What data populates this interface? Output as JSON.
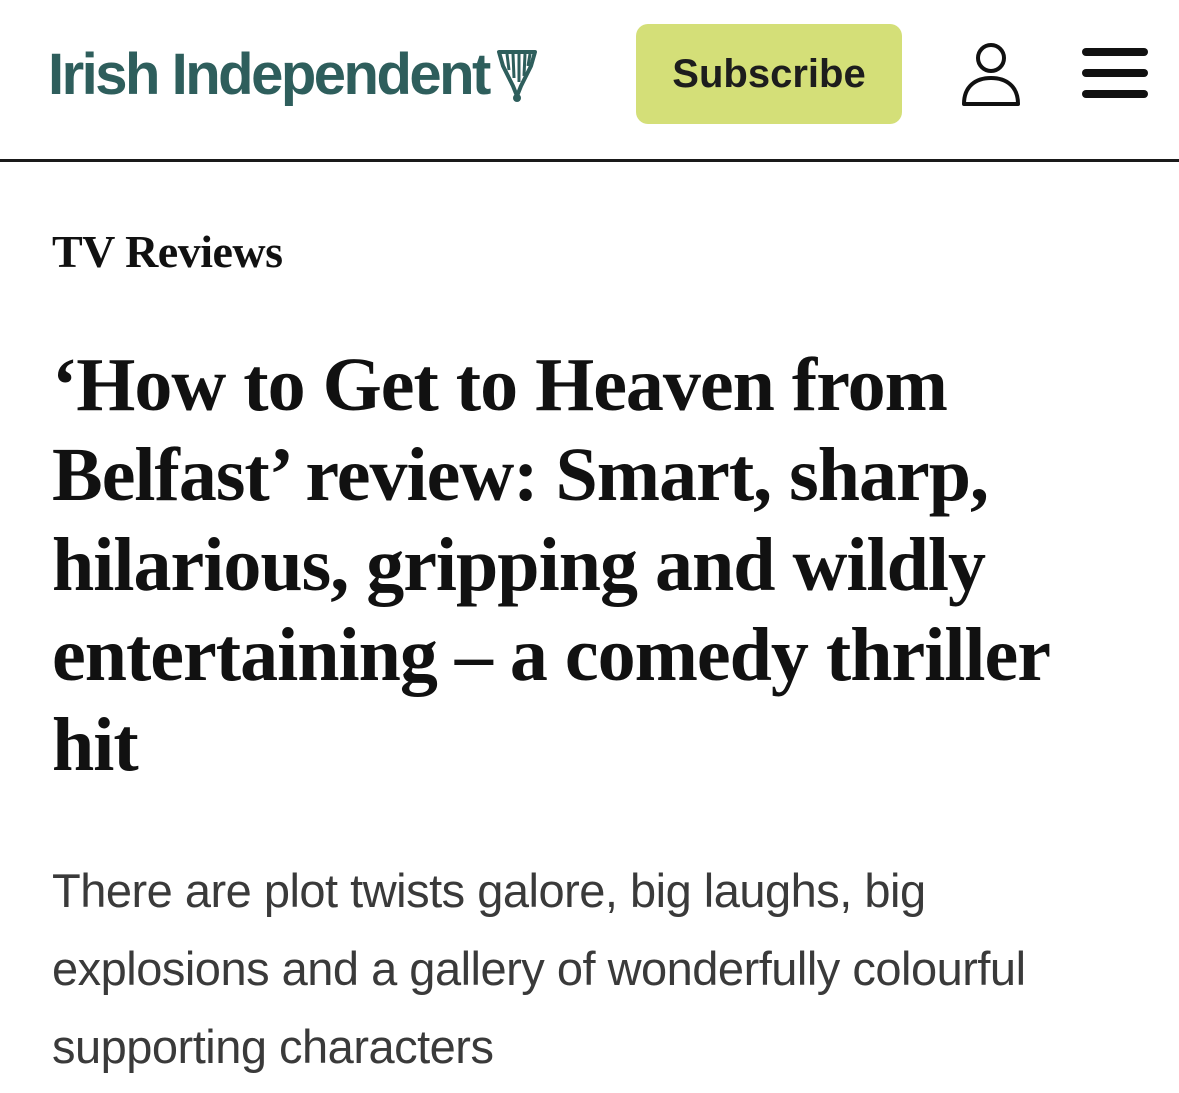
{
  "header": {
    "brand_name": "Irish Independent",
    "brand_icon": "harp-icon",
    "subscribe_label": "Subscribe",
    "account_icon": "user-icon",
    "menu_icon": "hamburger-menu-icon",
    "colors": {
      "brand": "#2e5e5c",
      "subscribe_bg": "#d4df78",
      "divider": "#1a1a1a"
    }
  },
  "article": {
    "section": "TV Reviews",
    "headline": "‘How to Get to Heaven from Belfast’ review: Smart, sharp, hilarious, gripping and wildly entertaining – a comedy thriller hit",
    "standfirst": "There are plot twists galore, big laughs, big explosions and a gallery of wonderfully colourful supporting characters"
  }
}
